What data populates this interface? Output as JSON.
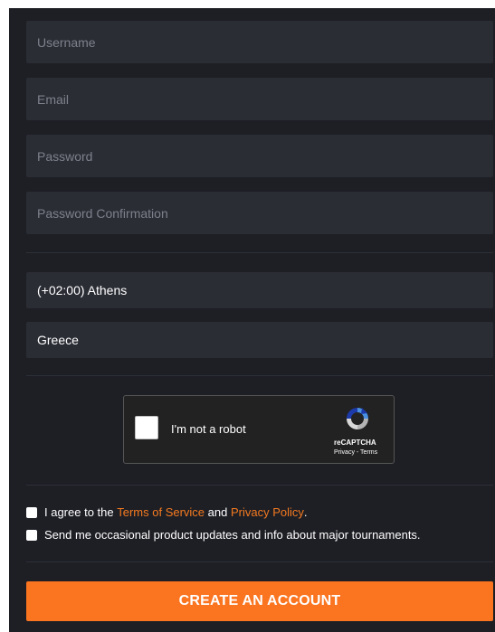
{
  "form": {
    "username_placeholder": "Username",
    "email_placeholder": "Email",
    "password_placeholder": "Password",
    "password_confirmation_placeholder": "Password Confirmation",
    "timezone_value": "(+02:00) Athens",
    "country_value": "Greece"
  },
  "captcha": {
    "label": "I'm not a robot",
    "brand": "reCAPTCHA",
    "links": "Privacy - Terms"
  },
  "agreements": {
    "terms_prefix": "I agree to the ",
    "terms_link": "Terms of Service",
    "terms_middle": " and ",
    "privacy_link": "Privacy Policy",
    "terms_suffix": ".",
    "updates_label": "Send me occasional product updates and info about major tournaments."
  },
  "submit": {
    "label": "CREATE AN ACCOUNT"
  },
  "colors": {
    "background": "#1e1f25",
    "field": "#2b2d35",
    "accent": "#fb7420",
    "link": "#f47a20"
  }
}
